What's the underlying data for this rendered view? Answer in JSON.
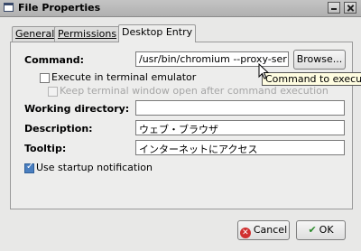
{
  "window": {
    "title": "File Properties"
  },
  "tabs": [
    {
      "label": "General",
      "active": false
    },
    {
      "label": "Permissions",
      "active": false
    },
    {
      "label": "Desktop Entry",
      "active": true
    }
  ],
  "form": {
    "command_label": "Command:",
    "command_value": "/usr/bin/chromium --proxy-ser",
    "browse_label": "Browse...",
    "execute_terminal_label": "Execute in terminal emulator",
    "execute_terminal_checked": false,
    "keep_window_label": "Keep terminal window open after command execution",
    "keep_window_checked": false,
    "working_dir_label": "Working directory:",
    "working_dir_value": "",
    "description_label": "Description:",
    "description_value": "ウェブ・ブラウザ",
    "tooltip_label": "Tooltip:",
    "tooltip_value": "インターネットにアクセス",
    "startup_notify_label": "Use startup notification",
    "startup_notify_checked": true
  },
  "tooltip_popup": "Command to execu",
  "buttons": {
    "cancel": "Cancel",
    "ok": "OK"
  },
  "icons": {
    "cancel": "cancel-icon",
    "ok": "ok-icon",
    "window": "window-icon",
    "pointer": "pointer-cursor-icon"
  }
}
